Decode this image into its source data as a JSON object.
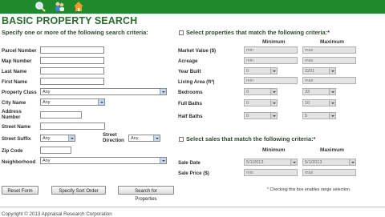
{
  "nav": {
    "icons": [
      "search-icon",
      "people-icon",
      "home-icon"
    ]
  },
  "title": "BASIC PROPERTY SEARCH",
  "left": {
    "heading": "Specify one or more of the following search criteria:",
    "parcel_label": "Parcel Number",
    "map_label": "Map Number",
    "last_label": "Last Name",
    "first_label": "First Name",
    "class_label": "Property Class",
    "class_value": "Any",
    "city_label": "City Name",
    "city_value": "Any",
    "address_label": "Address Number",
    "street_label": "Street Name",
    "suffix_label": "Street Suffix",
    "suffix_value": "Any",
    "direction_label": "Street Direction",
    "direction_value": "Any",
    "zip_label": "Zip Code",
    "neighborhood_label": "Neighborhood",
    "neighborhood_value": "Any"
  },
  "right": {
    "heading": "Select properties that match the following criteria:*",
    "min_header": "Minimum",
    "max_header": "Maximum",
    "rows": {
      "value_label": "Market Value ($)",
      "value_min": "min",
      "value_max": "max",
      "acreage_label": "Acreage",
      "acreage_min": "min",
      "acreage_max": "max",
      "year_label": "Year Built",
      "year_min": "0",
      "year_max": "2201",
      "living_label": "Living Area (ft²)",
      "living_min": "min",
      "living_max": "max",
      "bed_label": "Bedrooms",
      "bed_min": "0",
      "bed_max": "33",
      "full_label": "Full Baths",
      "full_min": "0",
      "full_max": "10",
      "half_label": "Half Baths",
      "half_min": "0",
      "half_max": "5"
    },
    "sales_heading": "Select sales that match the following criteria:*",
    "sales_min_header": "Minimum",
    "sales_max_header": "Maximum",
    "sale_date_label": "Sale Date",
    "sale_date_min": "5/1/2013",
    "sale_date_max": "5/1/2013",
    "sale_price_label": "Sale Price ($)",
    "sale_price_min": "min",
    "sale_price_max": "max"
  },
  "buttons": {
    "reset": "Reset Form",
    "sort": "Specify Sort Order",
    "search": "Search for Properties"
  },
  "note": "* Checking this box enables range selection.",
  "footer": "Copyright © 2013 Appraisal Research Corporation"
}
